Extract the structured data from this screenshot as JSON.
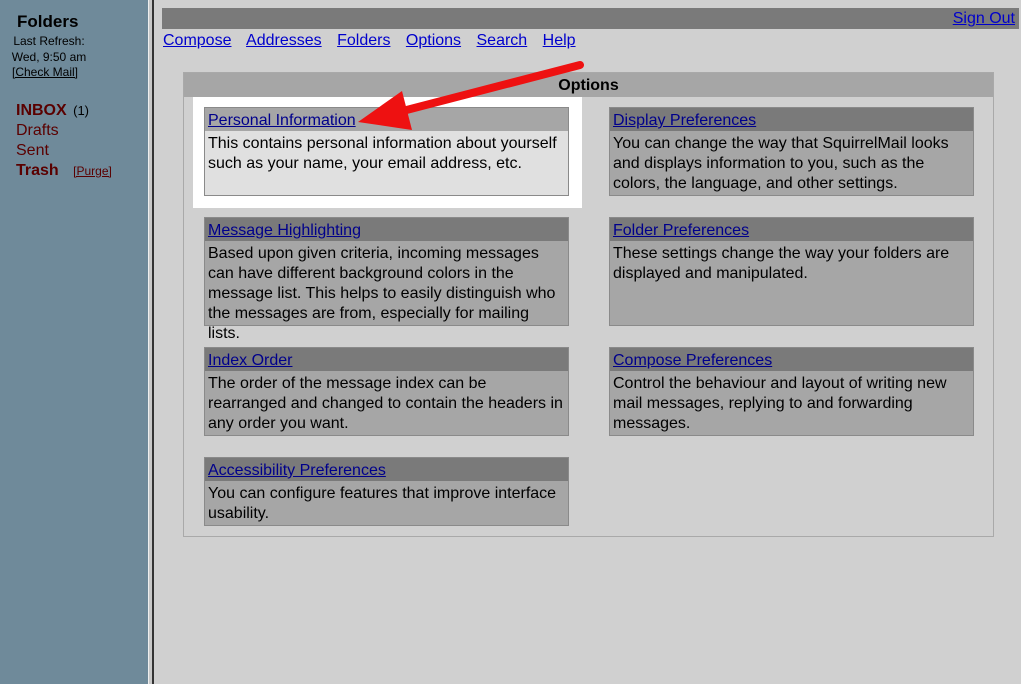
{
  "sidebar": {
    "title": "Folders",
    "refresh_line1": "Last Refresh:",
    "refresh_line2": "Wed, 9:50 am",
    "check_mail": "[Check Mail]",
    "folders": [
      {
        "label": "INBOX",
        "unread": "(1)"
      },
      {
        "label": "Drafts"
      },
      {
        "label": "Sent"
      },
      {
        "label": "Trash",
        "purge": "[Purge]"
      }
    ]
  },
  "topbar": {
    "signout": "Sign Out"
  },
  "nav": [
    "Compose",
    "Addresses",
    "Folders",
    "Options",
    "Search",
    "Help"
  ],
  "options": {
    "heading": "Options",
    "cards": [
      {
        "title": "Personal Information",
        "desc": "This contains personal information about yourself such as your name, your email address, etc."
      },
      {
        "title": "Display Preferences",
        "desc": "You can change the way that SquirrelMail looks and displays information to you, such as the colors, the language, and other settings."
      },
      {
        "title": "Message Highlighting",
        "desc": "Based upon given criteria, incoming messages can have different background colors in the message list. This helps to easily distinguish who the messages are from, especially for mailing lists."
      },
      {
        "title": "Folder Preferences",
        "desc": "These settings change the way your folders are displayed and manipulated."
      },
      {
        "title": "Index Order",
        "desc": "The order of the message index can be rearranged and changed to contain the headers in any order you want."
      },
      {
        "title": "Compose Preferences",
        "desc": "Control the behaviour and layout of writing new mail messages, replying to and forwarding messages."
      },
      {
        "title": "Accessibility Preferences",
        "desc": "You can configure features that improve interface usability."
      }
    ]
  },
  "colors": {
    "annotation_arrow": "#ee1111",
    "link": "#0000cc"
  }
}
